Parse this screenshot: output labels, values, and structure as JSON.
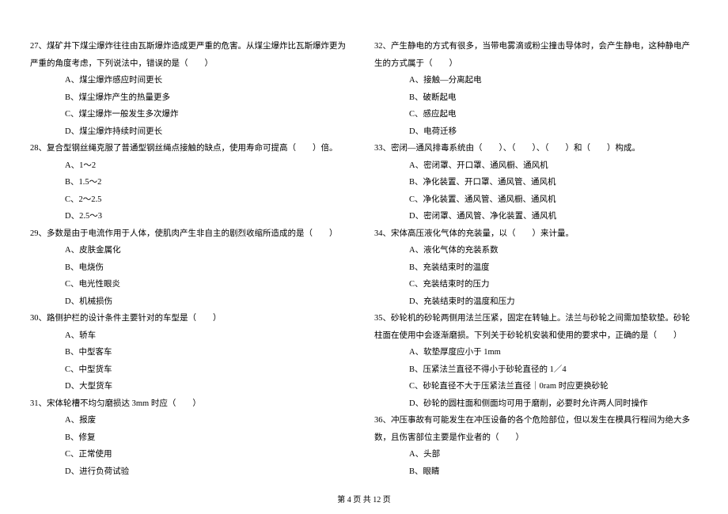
{
  "leftColumn": {
    "q27": {
      "text": "27、煤矿井下煤尘爆炸往往由瓦斯爆炸造成更严重的危害。从煤尘爆炸比瓦斯爆炸更为严重的角度考虑，下列说法中，错误的是（　　）",
      "a": "A、煤尘爆炸感应时间更长",
      "b": "B、煤尘爆炸产生的热量更多",
      "c": "C、煤尘爆炸一般发生多次爆炸",
      "d": "D、煤尘爆炸持续时间更长"
    },
    "q28": {
      "text": "28、复合型钢丝绳克服了普通型钢丝绳点接触的缺点，使用寿命可提高（　　）倍。",
      "a": "A、1～2",
      "b": "B、1.5～2",
      "c": "C、2～2.5",
      "d": "D、2.5～3"
    },
    "q29": {
      "text": "29、多数是由于电流作用于人体，使肌肉产生非自主的剧烈收缩所造成的是（　　）",
      "a": "A、皮肤金属化",
      "b": "B、电烧伤",
      "c": "C、电光性眼炎",
      "d": "D、机械损伤"
    },
    "q30": {
      "text": "30、路侧护栏的设计条件主要针对的车型是（　　）",
      "a": "A、轿车",
      "b": "B、中型客车",
      "c": "C、中型货车",
      "d": "D、大型货车"
    },
    "q31": {
      "text": "31、宋体轮槽不均匀磨损达 3mm 时应（　　）",
      "a": "A、报废",
      "b": "B、修复",
      "c": "C、正常使用",
      "d": "D、进行负荷试验"
    }
  },
  "rightColumn": {
    "q32": {
      "text": "32、产生静电的方式有很多，当带电雾滴或粉尘撞击导体时，会产生静电，这种静电产生的方式属于（　　）",
      "a": "A、接触—分离起电",
      "b": "B、破断起电",
      "c": "C、感应起电",
      "d": "D、电荷迁移"
    },
    "q33": {
      "text": "33、密闭—通风排毒系统由（　　）、（　　）、（　　）和（　　）构成。",
      "a": "A、密闭罩、开口罩、通风橱、通风机",
      "b": "B、净化装置、开口罩、通风管、通风机",
      "c": "C、净化装置、通风管、通风橱、通风机",
      "d": "D、密闭罩、通风管、净化装置、通风机"
    },
    "q34": {
      "text": "34、宋体高压液化气体的充装量，以（　　）来计量。",
      "a": "A、液化气体的充装系数",
      "b": "B、充装结束时的温度",
      "c": "C、充装结束时的压力",
      "d": "D、充装结束时的温度和压力"
    },
    "q35": {
      "text": "35、砂轮机的砂轮两侧用法兰压紧，固定在转轴上。法兰与砂轮之间需加垫软垫。砂轮柱面在使用中会逐渐磨损。下列关于砂轮机安装和使用的要求中，正确的是（　　）",
      "a": "A、软垫厚度应小于 1mm",
      "b": "B、压紧法兰直径不得小于砂轮直径的 1／4",
      "c": "C、砂轮直径不大于压紧法兰直径｜0ram 时应更换砂轮",
      "d": "D、砂轮的圆柱面和侧面均可用于磨削，必要时允许两人同时操作"
    },
    "q36": {
      "text": "36、冲压事故有可能发生在冲压设备的各个危险部位，但以发生在模具行程间为绝大多数，且伤害部位主要是作业者的（　　）",
      "a": "A、头部",
      "b": "B、眼睛"
    }
  },
  "footer": "第 4 页 共 12 页"
}
